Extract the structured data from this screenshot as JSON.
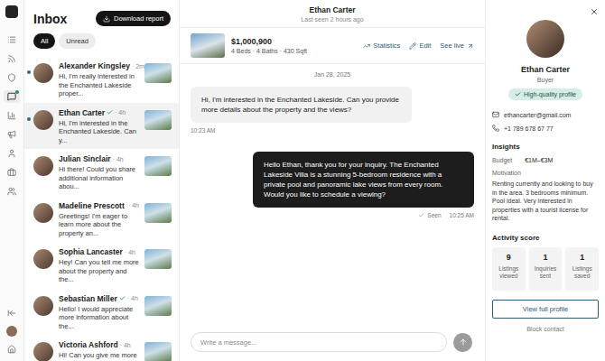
{
  "nav": {
    "items": [
      {
        "selected": false,
        "dot": false
      },
      {
        "selected": false,
        "dot": false
      },
      {
        "selected": false,
        "dot": false
      },
      {
        "selected": true,
        "dot": true
      },
      {
        "selected": false,
        "dot": false
      },
      {
        "selected": false,
        "dot": false
      },
      {
        "selected": false,
        "dot": false
      },
      {
        "selected": false,
        "dot": false
      },
      {
        "selected": false,
        "dot": false
      }
    ]
  },
  "inbox": {
    "title": "Inbox",
    "download": "Download report",
    "separator": "·",
    "filters": [
      {
        "label": "All",
        "selected": true
      },
      {
        "label": "Unread",
        "selected": false
      }
    ],
    "conversations": [
      {
        "name": "Alexander Kingsley",
        "verified": false,
        "time": "2m",
        "message": "Hi, I'm really interested in the Enchanted Lakeside proper...",
        "unread": true,
        "selected": false
      },
      {
        "name": "Ethan Carter",
        "verified": true,
        "time": "4h",
        "message": "Hi, I'm interested in the Enchanted Lakeside. Can y...",
        "unread": true,
        "selected": true
      },
      {
        "name": "Julian Sinclair",
        "verified": false,
        "time": "4h",
        "message": "Hi there! Could you share additional information abou...",
        "unread": false,
        "selected": false
      },
      {
        "name": "Madeline Prescott",
        "verified": true,
        "time": "4h",
        "message": "Greetings! I'm eager to learn more about the property an...",
        "unread": false,
        "selected": false
      },
      {
        "name": "Sophia Lancaster",
        "verified": false,
        "time": "4h",
        "message": "Hey! Can you tell me more about the property and the...",
        "unread": false,
        "selected": false
      },
      {
        "name": "Sebastian Miller",
        "verified": true,
        "time": "4h",
        "message": "Hello! I would appreciate more information about the...",
        "unread": false,
        "selected": false
      },
      {
        "name": "Victoria Ashford",
        "verified": false,
        "time": "4h",
        "message": "Hi! Can you give me more",
        "unread": false,
        "selected": false
      }
    ]
  },
  "chat": {
    "name": "Ethan Carter",
    "status": "Last seen 2 hours ago",
    "property": {
      "price": "$1,000,900",
      "details": "4 Beds · 4 Baths · 430 Sqft",
      "actions": [
        "Statistics",
        "Edit",
        "See live"
      ]
    },
    "date": "Jan 28, 2025",
    "messages": [
      {
        "kind": "incoming",
        "text": "Hi, I'm interested in the Enchanted Lakeside. Can you provide more details about the property and the views?",
        "time": "10:23 AM",
        "status": ""
      },
      {
        "kind": "outgoing",
        "text": "Hello Ethan, thank you for your inquiry. The Enchanted Lakeside Villa is a stunning 5-bedroom residence with a private pool and panoramic lake views from every room. Would you like to schedule a viewing?",
        "time": "10:25 AM",
        "status": "Seen"
      }
    ],
    "placeholder": "Write a message..."
  },
  "profile": {
    "name": "Ethan Carter",
    "role": "Buyer",
    "badge": "High-quality profile",
    "email": "ethancarter@gmail.com",
    "phone": "+1 789 678 67 77",
    "insights": "Insights",
    "budgetLabel": "Budget",
    "budget": "€1M–€3M",
    "motivationLabel": "Motivation",
    "motivation": "Renting currently and looking to buy in the area. 3 bedrooms minimum. Pool ideal. Very interested in properties with a tourist license for rental.",
    "activityTitle": "Activity score",
    "scores": [
      {
        "value": "9",
        "label": "Listings viewed"
      },
      {
        "value": "1",
        "label": "Inquiries sent"
      },
      {
        "value": "1",
        "label": "Listings saved"
      }
    ],
    "button": "View full profile",
    "block": "Block contact"
  }
}
